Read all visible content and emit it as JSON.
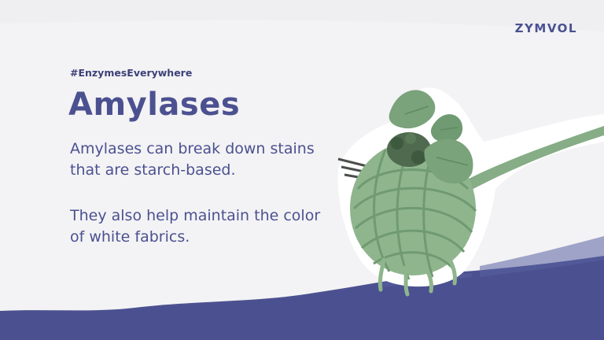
{
  "brand": {
    "logo_text": "ZYMVOL"
  },
  "hashtag": "#EnzymesEverywhere",
  "title": "Amylases",
  "paragraphs": [
    "Amylases can break down stains that are starch-based.",
    "They also help maintain the color of white fabrics."
  ],
  "colors": {
    "accent": "#4b5190",
    "background": "#f3f3f5",
    "pasta_green": "#8fb58d",
    "basil_green": "#6f9a72"
  },
  "illustration": {
    "icon": "pasta-on-fork-icon"
  }
}
